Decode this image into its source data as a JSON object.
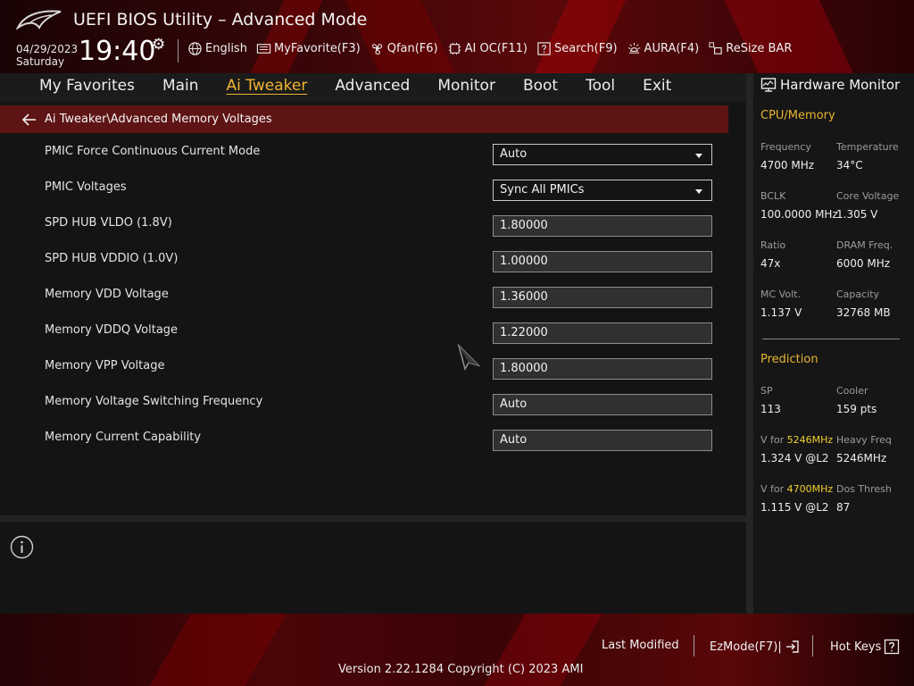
{
  "header": {
    "title": "UEFI BIOS Utility – Advanced Mode",
    "date": "04/29/2023",
    "day": "Saturday",
    "time": "19:40"
  },
  "toolbar": [
    {
      "label": "English",
      "icon": "globe-icon"
    },
    {
      "label": "MyFavorite(F3)",
      "icon": "favorite-keyboard-icon"
    },
    {
      "label": "Qfan(F6)",
      "icon": "fan-icon"
    },
    {
      "label": "AI OC(F11)",
      "icon": "ai-chip-icon"
    },
    {
      "label": "Search(F9)",
      "icon": "search-question-icon"
    },
    {
      "label": "AURA(F4)",
      "icon": "aura-light-icon"
    },
    {
      "label": "ReSize BAR",
      "icon": "resize-bar-icon"
    }
  ],
  "menu": {
    "items": [
      "My Favorites",
      "Main",
      "Ai Tweaker",
      "Advanced",
      "Monitor",
      "Boot",
      "Tool",
      "Exit"
    ],
    "active": "Ai Tweaker"
  },
  "breadcrumb": "Ai Tweaker\\Advanced Memory Voltages",
  "settings": [
    {
      "label": "PMIC Force Continuous Current Mode",
      "value": "Auto",
      "type": "select"
    },
    {
      "label": "PMIC Voltages",
      "value": "Sync All PMICs",
      "type": "select"
    },
    {
      "label": "SPD HUB VLDO (1.8V)",
      "value": "1.80000",
      "type": "text"
    },
    {
      "label": "SPD HUB VDDIO (1.0V)",
      "value": "1.00000",
      "type": "text"
    },
    {
      "label": "Memory VDD Voltage",
      "value": "1.36000",
      "type": "text"
    },
    {
      "label": "Memory VDDQ Voltage",
      "value": "1.22000",
      "type": "text"
    },
    {
      "label": "Memory VPP Voltage",
      "value": "1.80000",
      "type": "text"
    },
    {
      "label": "Memory Voltage Switching Frequency",
      "value": "Auto",
      "type": "text"
    },
    {
      "label": "Memory Current Capability",
      "value": "Auto",
      "type": "text"
    }
  ],
  "hardware_monitor": {
    "title": "Hardware Monitor",
    "cpu_memory": {
      "title": "CPU/Memory",
      "frequency_label": "Frequency",
      "frequency": "4700 MHz",
      "temperature_label": "Temperature",
      "temperature": "34°C",
      "bclk_label": "BCLK",
      "bclk": "100.0000 MHz",
      "core_voltage_label": "Core Voltage",
      "core_voltage": "1.305 V",
      "ratio_label": "Ratio",
      "ratio": "47x",
      "dram_freq_label": "DRAM Freq.",
      "dram_freq": "6000 MHz",
      "mc_volt_label": "MC Volt.",
      "mc_volt": "1.137 V",
      "capacity_label": "Capacity",
      "capacity": "32768 MB"
    },
    "prediction": {
      "title": "Prediction",
      "sp_label": "SP",
      "sp": "113",
      "cooler_label": "Cooler",
      "cooler": "159 pts",
      "v_for_prefix": "V for ",
      "v_for_1_freq": "5246MHz",
      "v_for_1": "1.324 V @L2",
      "heavy_freq_label": "Heavy Freq",
      "heavy_freq": "5246MHz",
      "v_for_2_freq": "4700MHz",
      "v_for_2": "1.115 V @L2",
      "dos_thresh_label": "Dos Thresh",
      "dos_thresh": "87"
    }
  },
  "footer": {
    "last_modified": "Last Modified",
    "ezmode": "EzMode(F7)|",
    "hot_keys": "Hot Keys",
    "version": "Version 2.22.1284 Copyright (C) 2023 AMI"
  },
  "colors": {
    "accent": "#f0b431",
    "breadcrumb_bg": "#5e1414",
    "highlight_freq": "#f0d030"
  }
}
